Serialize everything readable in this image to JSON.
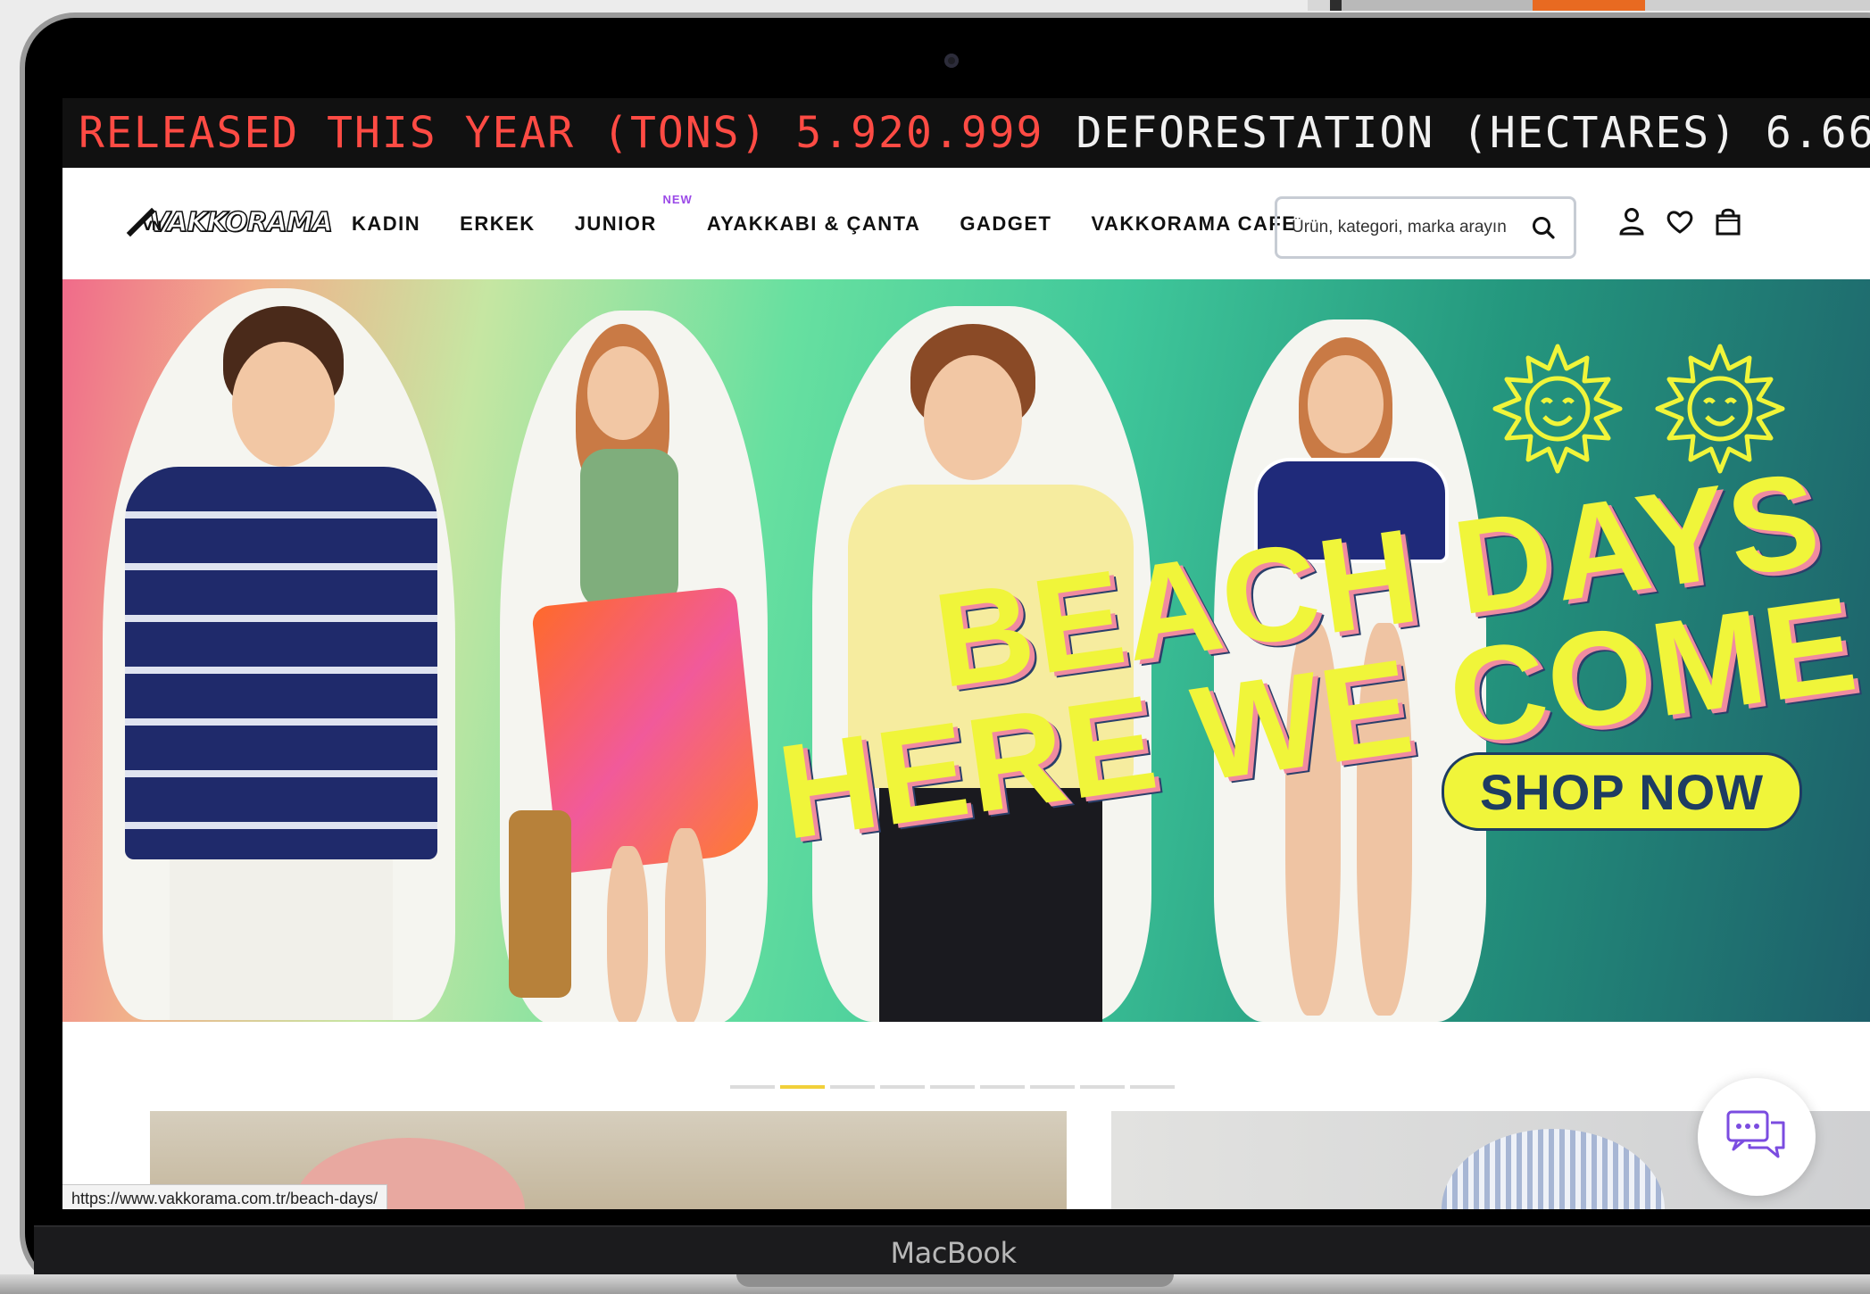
{
  "ticker": {
    "released_label": "RELEASED THIS YEAR (TONS) 5.920.999",
    "deforestation_label": "DEFORESTATION (HECTARES) 6.66"
  },
  "header": {
    "logo": "VAKKORAMA",
    "nav": [
      {
        "label": "KADIN"
      },
      {
        "label": "ERKEK"
      },
      {
        "label": "JUNIOR",
        "badge": "NEW"
      },
      {
        "label": "AYAKKABI & ÇANTA"
      },
      {
        "label": "GADGET"
      },
      {
        "label": "VAKKORAMA CAFE"
      }
    ],
    "search_placeholder": "Ürün, kategori, marka arayın",
    "icons": [
      "user-icon",
      "heart-icon",
      "bag-icon"
    ]
  },
  "hero": {
    "headline_line1": "BEACH DAYS",
    "headline_line2": "HERE WE COME",
    "cta": "SHOP NOW",
    "colors": {
      "headline": "#f0f53a",
      "cta_text": "#1e3c62"
    }
  },
  "carousel": {
    "total": 9,
    "active_index": 1
  },
  "status_bar": {
    "url": "https://www.vakkorama.com.tr/beach-days/"
  },
  "device": {
    "label": "MacBook"
  }
}
